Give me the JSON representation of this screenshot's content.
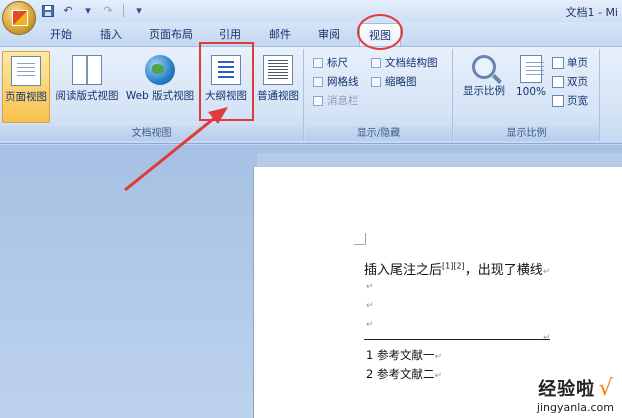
{
  "window": {
    "title": "文档1 - Mi"
  },
  "qat": {
    "undo": "↶",
    "redo": "↷",
    "customize": "▾"
  },
  "tabs": [
    {
      "label": "开始"
    },
    {
      "label": "插入"
    },
    {
      "label": "页面布局"
    },
    {
      "label": "引用"
    },
    {
      "label": "邮件"
    },
    {
      "label": "审阅"
    },
    {
      "label": "视图",
      "active": true
    }
  ],
  "groups": {
    "doc_views": {
      "label": "文档视图",
      "buttons": [
        "页面视图",
        "阅读版式视图",
        "Web 版式视图",
        "大纲视图",
        "普通视图"
      ],
      "selected": "页面视图"
    },
    "show_hide": {
      "label": "显示/隐藏",
      "items": [
        "标尺",
        "网格线",
        "消息栏",
        "文档结构图",
        "缩略图"
      ]
    },
    "zoom": {
      "label": "显示比例",
      "zoom_label": "显示比例",
      "percent": "100%",
      "one_page": "单页",
      "two_pages": "双页",
      "page_width": "页宽"
    }
  },
  "document": {
    "line1_prefix": "插入尾注之后",
    "line1_refs": "[1][2]",
    "line1_suffix": "，出现了横线",
    "para_mark": "↵",
    "refs": [
      "1 参考文献一",
      "2 参考文献二"
    ]
  },
  "watermark": {
    "title": "经验啦",
    "check": "√",
    "url": "jingyanla.com"
  },
  "colors": {
    "annotation": "#e23a3a",
    "ribbon": "#d4e3f6",
    "selected": "#f8c04e"
  }
}
